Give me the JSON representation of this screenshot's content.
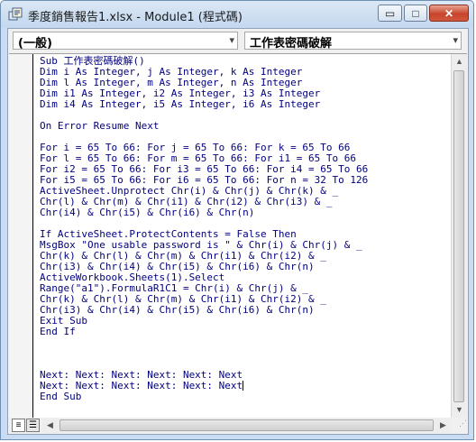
{
  "window": {
    "title": "季度銷售報告1.xlsx - Module1 (程式碼)",
    "minimize_glyph": "▭",
    "maximize_glyph": "□",
    "close_glyph": "✕",
    "close_color": "#c7442c"
  },
  "combos": {
    "object": "(一般)",
    "procedure": "工作表密碼破解",
    "arrow_glyph": "▾"
  },
  "code": {
    "lines": [
      "Sub 工作表密碼破解()",
      "Dim i As Integer, j As Integer, k As Integer",
      "Dim l As Integer, m As Integer, n As Integer",
      "Dim i1 As Integer, i2 As Integer, i3 As Integer",
      "Dim i4 As Integer, i5 As Integer, i6 As Integer",
      "",
      "On Error Resume Next",
      "",
      "For i = 65 To 66: For j = 65 To 66: For k = 65 To 66",
      "For l = 65 To 66: For m = 65 To 66: For i1 = 65 To 66",
      "For i2 = 65 To 66: For i3 = 65 To 66: For i4 = 65 To 66",
      "For i5 = 65 To 66: For i6 = 65 To 66: For n = 32 To 126",
      "ActiveSheet.Unprotect Chr(i) & Chr(j) & Chr(k) & _",
      "Chr(l) & Chr(m) & Chr(i1) & Chr(i2) & Chr(i3) & _",
      "Chr(i4) & Chr(i5) & Chr(i6) & Chr(n)",
      "",
      "If ActiveSheet.ProtectContents = False Then",
      "MsgBox \"One usable password is \" & Chr(i) & Chr(j) & _",
      "Chr(k) & Chr(l) & Chr(m) & Chr(i1) & Chr(i2) & _",
      "Chr(i3) & Chr(i4) & Chr(i5) & Chr(i6) & Chr(n)",
      "ActiveWorkbook.Sheets(1).Select",
      "Range(\"a1\").FormulaR1C1 = Chr(i) & Chr(j) & _",
      "Chr(k) & Chr(l) & Chr(m) & Chr(i1) & Chr(i2) & _",
      "Chr(i3) & Chr(i4) & Chr(i5) & Chr(i6) & Chr(n)",
      "Exit Sub",
      "End If",
      "",
      "",
      "",
      "Next: Next: Next: Next: Next: Next",
      "Next: Next: Next: Next: Next: Next",
      "End Sub"
    ],
    "text_color": "#00007f"
  },
  "scroll": {
    "up_glyph": "▲",
    "down_glyph": "▼",
    "left_glyph": "◀",
    "right_glyph": "▶"
  },
  "view_buttons": {
    "procedure_view_glyph": "≡",
    "full_module_glyph": "☰"
  }
}
